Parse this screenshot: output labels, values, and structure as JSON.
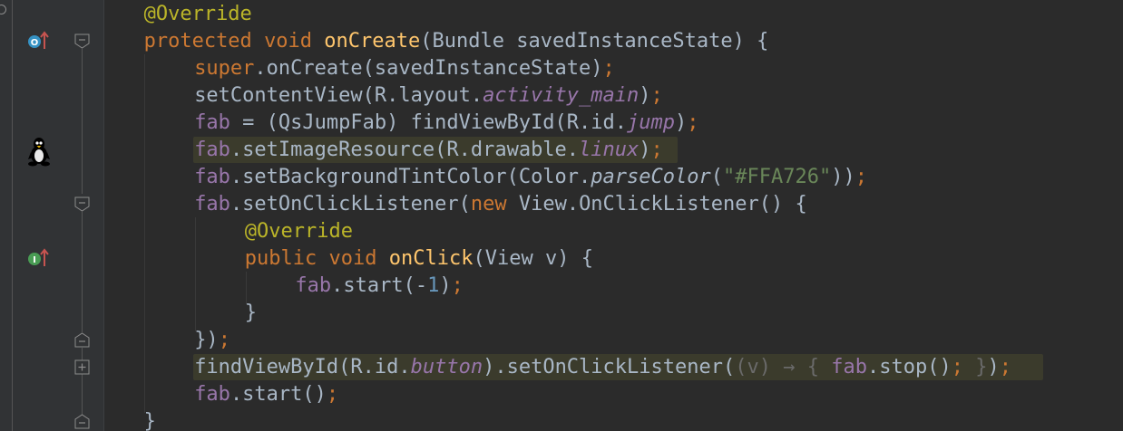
{
  "editor": {
    "language": "java",
    "lines": [
      {
        "indent": 4,
        "tokens": [
          {
            "t": "@Override",
            "c": "ann"
          }
        ]
      },
      {
        "indent": 4,
        "tokens": [
          {
            "t": "protected",
            "c": "kw"
          },
          {
            "t": " "
          },
          {
            "t": "void",
            "c": "kw"
          },
          {
            "t": " "
          },
          {
            "t": "onCreate",
            "c": "fn"
          },
          {
            "t": "(Bundle savedInstanceState) {"
          }
        ]
      },
      {
        "indent": 8,
        "tokens": [
          {
            "t": "super",
            "c": "kw"
          },
          {
            "t": ".onCreate(savedInstanceState)"
          },
          {
            "t": ";",
            "c": "kw"
          }
        ]
      },
      {
        "indent": 8,
        "tokens": [
          {
            "t": "setContentView(R.layout."
          },
          {
            "t": "activity_main",
            "c": "ifld"
          },
          {
            "t": ")"
          },
          {
            "t": ";",
            "c": "kw"
          }
        ]
      },
      {
        "indent": 8,
        "tokens": [
          {
            "t": "fab",
            "c": "fld"
          },
          {
            "t": " = (QsJumpFab) findViewById(R.id."
          },
          {
            "t": "jump",
            "c": "ifld"
          },
          {
            "t": ")"
          },
          {
            "t": ";",
            "c": "kw"
          }
        ]
      },
      {
        "indent": 8,
        "highlighted": true,
        "tokens": [
          {
            "t": "fab",
            "c": "fld"
          },
          {
            "t": ".setImageResource(R.drawable."
          },
          {
            "t": "linux",
            "c": "ifld"
          },
          {
            "t": ")"
          },
          {
            "t": ";",
            "c": "kw"
          }
        ]
      },
      {
        "indent": 8,
        "tokens": [
          {
            "t": "fab",
            "c": "fld"
          },
          {
            "t": ".setBackgroundTintColor(Color."
          },
          {
            "t": "parseColor",
            "c": "sm"
          },
          {
            "t": "("
          },
          {
            "t": "\"#FFA726\"",
            "c": "str"
          },
          {
            "t": "))"
          },
          {
            "t": ";",
            "c": "kw"
          }
        ]
      },
      {
        "indent": 8,
        "tokens": [
          {
            "t": "fab",
            "c": "fld"
          },
          {
            "t": ".setOnClickListener("
          },
          {
            "t": "new",
            "c": "kw"
          },
          {
            "t": " View.OnClickListener() {"
          }
        ]
      },
      {
        "indent": 12,
        "tokens": [
          {
            "t": "@Override",
            "c": "ann"
          }
        ]
      },
      {
        "indent": 12,
        "tokens": [
          {
            "t": "public",
            "c": "kw"
          },
          {
            "t": " "
          },
          {
            "t": "void",
            "c": "kw"
          },
          {
            "t": " "
          },
          {
            "t": "onClick",
            "c": "fn"
          },
          {
            "t": "(View v) {"
          }
        ]
      },
      {
        "indent": 16,
        "tokens": [
          {
            "t": "fab",
            "c": "fld"
          },
          {
            "t": ".start(-"
          },
          {
            "t": "1",
            "c": "num"
          },
          {
            "t": ")"
          },
          {
            "t": ";",
            "c": "kw"
          }
        ]
      },
      {
        "indent": 12,
        "tokens": [
          {
            "t": "}"
          }
        ]
      },
      {
        "indent": 8,
        "tokens": [
          {
            "t": "})"
          },
          {
            "t": ";",
            "c": "kw"
          }
        ]
      },
      {
        "indent": 8,
        "highlighted": true,
        "tokens": [
          {
            "t": "findViewById(R.id."
          },
          {
            "t": "button",
            "c": "ifld"
          },
          {
            "t": ").setOnClickListener("
          },
          {
            "t": "(v) → { ",
            "c": "lambda-arg"
          },
          {
            "t": "fab",
            "c": "fld"
          },
          {
            "t": ".stop()"
          },
          {
            "t": "; ",
            "c": "kw"
          },
          {
            "t": "}",
            "c": "lambda-arg"
          },
          {
            "t": ")"
          },
          {
            "t": ";",
            "c": "kw"
          }
        ]
      },
      {
        "indent": 8,
        "tokens": [
          {
            "t": "fab",
            "c": "fld"
          },
          {
            "t": ".start()"
          },
          {
            "t": ";",
            "c": "kw"
          }
        ]
      },
      {
        "indent": 4,
        "tokens": [
          {
            "t": "}"
          }
        ]
      }
    ]
  },
  "gutter": {
    "override_badge": "O",
    "implement_badge": "I",
    "colors": {
      "override": "#3592c4",
      "implement": "#499c54",
      "arrow": "#c75450",
      "fold": "#8c8c8c"
    },
    "icons": [
      "override-method-icon",
      "linux-penguin-icon",
      "implement-method-icon",
      "fold-collapse-icon",
      "fold-expand-icon"
    ]
  },
  "theme": {
    "background": "#2b2b2b",
    "gutter_background": "#313335",
    "default_text": "#a9b7c6",
    "keyword": "#cc7832",
    "annotation": "#bbb529",
    "method_declaration": "#ffc66d",
    "field": "#9876aa",
    "string": "#6a8759",
    "number": "#6897bb",
    "highlight": "#3b3b2c"
  }
}
